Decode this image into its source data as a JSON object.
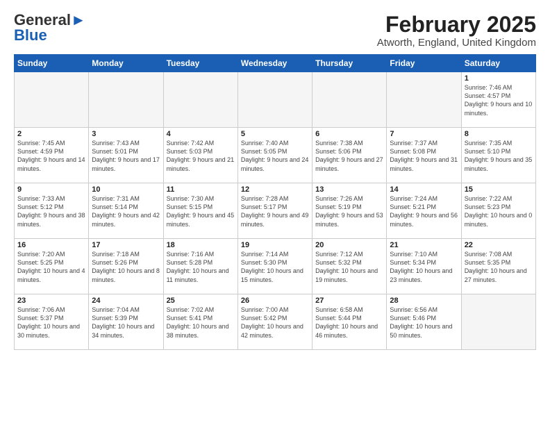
{
  "logo": {
    "line1": "General",
    "line2": "Blue"
  },
  "header": {
    "month": "February 2025",
    "location": "Atworth, England, United Kingdom"
  },
  "weekdays": [
    "Sunday",
    "Monday",
    "Tuesday",
    "Wednesday",
    "Thursday",
    "Friday",
    "Saturday"
  ],
  "weeks": [
    [
      {
        "day": "",
        "info": "",
        "empty": true
      },
      {
        "day": "",
        "info": "",
        "empty": true
      },
      {
        "day": "",
        "info": "",
        "empty": true
      },
      {
        "day": "",
        "info": "",
        "empty": true
      },
      {
        "day": "",
        "info": "",
        "empty": true
      },
      {
        "day": "",
        "info": "",
        "empty": true
      },
      {
        "day": "1",
        "info": "Sunrise: 7:46 AM\nSunset: 4:57 PM\nDaylight: 9 hours and 10 minutes."
      }
    ],
    [
      {
        "day": "2",
        "info": "Sunrise: 7:45 AM\nSunset: 4:59 PM\nDaylight: 9 hours and 14 minutes."
      },
      {
        "day": "3",
        "info": "Sunrise: 7:43 AM\nSunset: 5:01 PM\nDaylight: 9 hours and 17 minutes."
      },
      {
        "day": "4",
        "info": "Sunrise: 7:42 AM\nSunset: 5:03 PM\nDaylight: 9 hours and 21 minutes."
      },
      {
        "day": "5",
        "info": "Sunrise: 7:40 AM\nSunset: 5:05 PM\nDaylight: 9 hours and 24 minutes."
      },
      {
        "day": "6",
        "info": "Sunrise: 7:38 AM\nSunset: 5:06 PM\nDaylight: 9 hours and 27 minutes."
      },
      {
        "day": "7",
        "info": "Sunrise: 7:37 AM\nSunset: 5:08 PM\nDaylight: 9 hours and 31 minutes."
      },
      {
        "day": "8",
        "info": "Sunrise: 7:35 AM\nSunset: 5:10 PM\nDaylight: 9 hours and 35 minutes."
      }
    ],
    [
      {
        "day": "9",
        "info": "Sunrise: 7:33 AM\nSunset: 5:12 PM\nDaylight: 9 hours and 38 minutes."
      },
      {
        "day": "10",
        "info": "Sunrise: 7:31 AM\nSunset: 5:14 PM\nDaylight: 9 hours and 42 minutes."
      },
      {
        "day": "11",
        "info": "Sunrise: 7:30 AM\nSunset: 5:15 PM\nDaylight: 9 hours and 45 minutes."
      },
      {
        "day": "12",
        "info": "Sunrise: 7:28 AM\nSunset: 5:17 PM\nDaylight: 9 hours and 49 minutes."
      },
      {
        "day": "13",
        "info": "Sunrise: 7:26 AM\nSunset: 5:19 PM\nDaylight: 9 hours and 53 minutes."
      },
      {
        "day": "14",
        "info": "Sunrise: 7:24 AM\nSunset: 5:21 PM\nDaylight: 9 hours and 56 minutes."
      },
      {
        "day": "15",
        "info": "Sunrise: 7:22 AM\nSunset: 5:23 PM\nDaylight: 10 hours and 0 minutes."
      }
    ],
    [
      {
        "day": "16",
        "info": "Sunrise: 7:20 AM\nSunset: 5:25 PM\nDaylight: 10 hours and 4 minutes."
      },
      {
        "day": "17",
        "info": "Sunrise: 7:18 AM\nSunset: 5:26 PM\nDaylight: 10 hours and 8 minutes."
      },
      {
        "day": "18",
        "info": "Sunrise: 7:16 AM\nSunset: 5:28 PM\nDaylight: 10 hours and 11 minutes."
      },
      {
        "day": "19",
        "info": "Sunrise: 7:14 AM\nSunset: 5:30 PM\nDaylight: 10 hours and 15 minutes."
      },
      {
        "day": "20",
        "info": "Sunrise: 7:12 AM\nSunset: 5:32 PM\nDaylight: 10 hours and 19 minutes."
      },
      {
        "day": "21",
        "info": "Sunrise: 7:10 AM\nSunset: 5:34 PM\nDaylight: 10 hours and 23 minutes."
      },
      {
        "day": "22",
        "info": "Sunrise: 7:08 AM\nSunset: 5:35 PM\nDaylight: 10 hours and 27 minutes."
      }
    ],
    [
      {
        "day": "23",
        "info": "Sunrise: 7:06 AM\nSunset: 5:37 PM\nDaylight: 10 hours and 30 minutes."
      },
      {
        "day": "24",
        "info": "Sunrise: 7:04 AM\nSunset: 5:39 PM\nDaylight: 10 hours and 34 minutes."
      },
      {
        "day": "25",
        "info": "Sunrise: 7:02 AM\nSunset: 5:41 PM\nDaylight: 10 hours and 38 minutes."
      },
      {
        "day": "26",
        "info": "Sunrise: 7:00 AM\nSunset: 5:42 PM\nDaylight: 10 hours and 42 minutes."
      },
      {
        "day": "27",
        "info": "Sunrise: 6:58 AM\nSunset: 5:44 PM\nDaylight: 10 hours and 46 minutes."
      },
      {
        "day": "28",
        "info": "Sunrise: 6:56 AM\nSunset: 5:46 PM\nDaylight: 10 hours and 50 minutes."
      },
      {
        "day": "",
        "info": "",
        "empty": true
      }
    ]
  ]
}
